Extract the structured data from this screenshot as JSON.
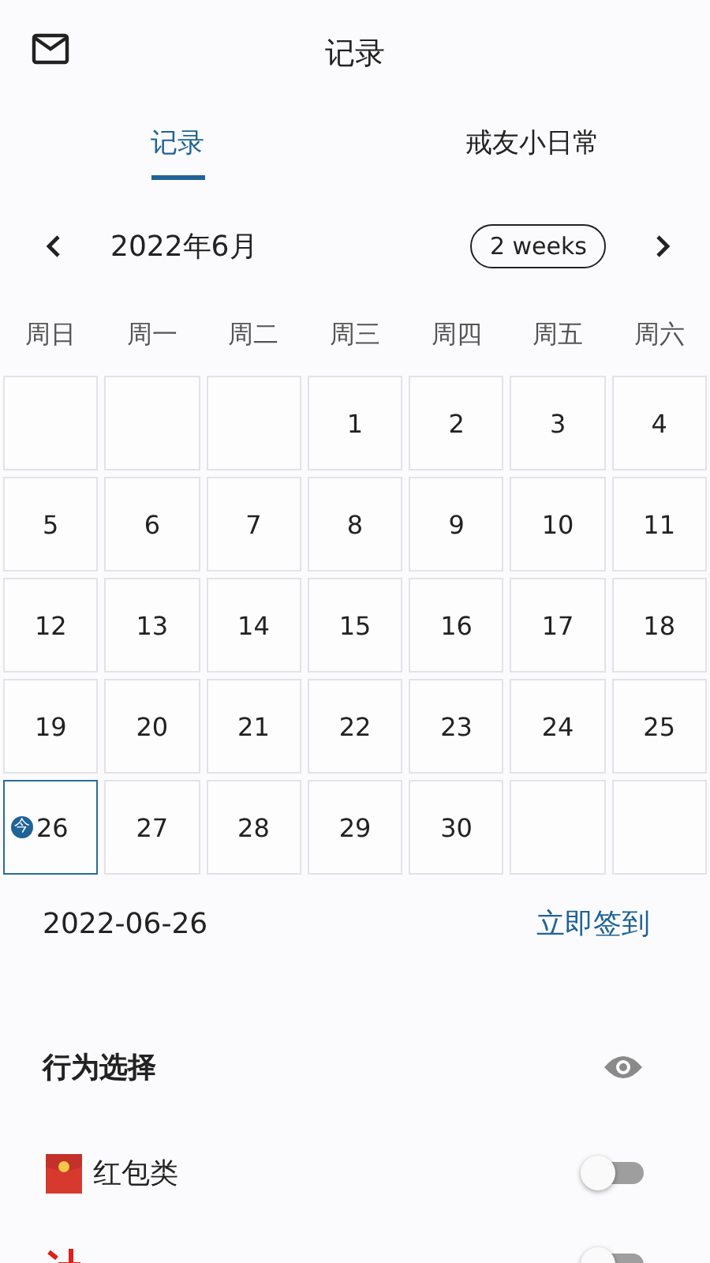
{
  "header": {
    "title": "记录"
  },
  "tabs": [
    {
      "label": "记录",
      "selected": true
    },
    {
      "label": "戒友小日常",
      "selected": false
    }
  ],
  "month": {
    "label": "2022年6月",
    "range": "2 weeks"
  },
  "weekdays": [
    "周日",
    "周一",
    "周二",
    "周三",
    "周四",
    "周五",
    "周六"
  ],
  "calendar": [
    [
      {
        "kind": "blank"
      },
      {
        "kind": "blank"
      },
      {
        "kind": "blank"
      },
      {
        "kind": "day",
        "day": "1",
        "today": false
      },
      {
        "kind": "day",
        "day": "2",
        "today": false
      },
      {
        "kind": "day",
        "day": "3",
        "today": false
      },
      {
        "kind": "day",
        "day": "4",
        "today": false
      }
    ],
    [
      {
        "kind": "day",
        "day": "5",
        "today": false
      },
      {
        "kind": "day",
        "day": "6",
        "today": false
      },
      {
        "kind": "day",
        "day": "7",
        "today": false
      },
      {
        "kind": "day",
        "day": "8",
        "today": false
      },
      {
        "kind": "day",
        "day": "9",
        "today": false
      },
      {
        "kind": "day",
        "day": "10",
        "today": false
      },
      {
        "kind": "day",
        "day": "11",
        "today": false
      }
    ],
    [
      {
        "kind": "day",
        "day": "12",
        "today": false
      },
      {
        "kind": "day",
        "day": "13",
        "today": false
      },
      {
        "kind": "day",
        "day": "14",
        "today": false
      },
      {
        "kind": "day",
        "day": "15",
        "today": false
      },
      {
        "kind": "day",
        "day": "16",
        "today": false
      },
      {
        "kind": "day",
        "day": "17",
        "today": false
      },
      {
        "kind": "day",
        "day": "18",
        "today": false
      }
    ],
    [
      {
        "kind": "day",
        "day": "19",
        "today": false
      },
      {
        "kind": "day",
        "day": "20",
        "today": false
      },
      {
        "kind": "day",
        "day": "21",
        "today": false
      },
      {
        "kind": "day",
        "day": "22",
        "today": false
      },
      {
        "kind": "day",
        "day": "23",
        "today": false
      },
      {
        "kind": "day",
        "day": "24",
        "today": false
      },
      {
        "kind": "day",
        "day": "25",
        "today": false
      }
    ],
    [
      {
        "kind": "day",
        "day": "26",
        "today": true,
        "badge": "今"
      },
      {
        "kind": "day",
        "day": "27",
        "today": false
      },
      {
        "kind": "day",
        "day": "28",
        "today": false
      },
      {
        "kind": "day",
        "day": "29",
        "today": false
      },
      {
        "kind": "day",
        "day": "30",
        "today": false
      },
      {
        "kind": "blank"
      },
      {
        "kind": "blank"
      }
    ]
  ],
  "selected_date": {
    "date": "2022-06-26",
    "action": "立即签到"
  },
  "behaviors": {
    "title": "行为选择",
    "items": [
      {
        "kind": "envelope",
        "label": "红包类",
        "on": false
      },
      {
        "kind": "mark",
        "on": false
      }
    ]
  }
}
